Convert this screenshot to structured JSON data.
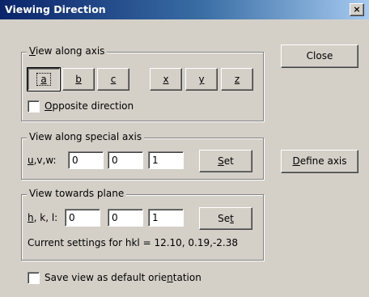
{
  "window": {
    "title": "Viewing Direction",
    "close_glyph": "×"
  },
  "view_axis": {
    "legend_pre": "",
    "legend_u": "V",
    "legend_post": "iew along axis",
    "buttons": [
      {
        "u": "a"
      },
      {
        "u": "b"
      },
      {
        "u": "c"
      },
      {
        "u": "x"
      },
      {
        "u": "y"
      },
      {
        "u": "z"
      }
    ],
    "opposite": {
      "u": "O",
      "rest": "pposite direction",
      "checked": false
    }
  },
  "close_button": {
    "label": "Close"
  },
  "special_axis": {
    "legend": "View along special axis",
    "label_u": "u",
    "label_rest": ",v,w:",
    "values": [
      "0",
      "0",
      "1"
    ],
    "set_u": "S",
    "set_rest": "et"
  },
  "define_axis_button": {
    "u": "D",
    "rest": "efine axis"
  },
  "plane": {
    "legend": "View towards plane",
    "label_u": "h",
    "label_rest": ", k, l:",
    "values": [
      "0",
      "0",
      "1"
    ],
    "set_pre": "Se",
    "set_u": "t",
    "current": "Current settings for hkl = 12.10, 0.19,-2.38"
  },
  "save_default": {
    "pre": "Save view as default orie",
    "u": "n",
    "post": "tation",
    "checked": false
  }
}
